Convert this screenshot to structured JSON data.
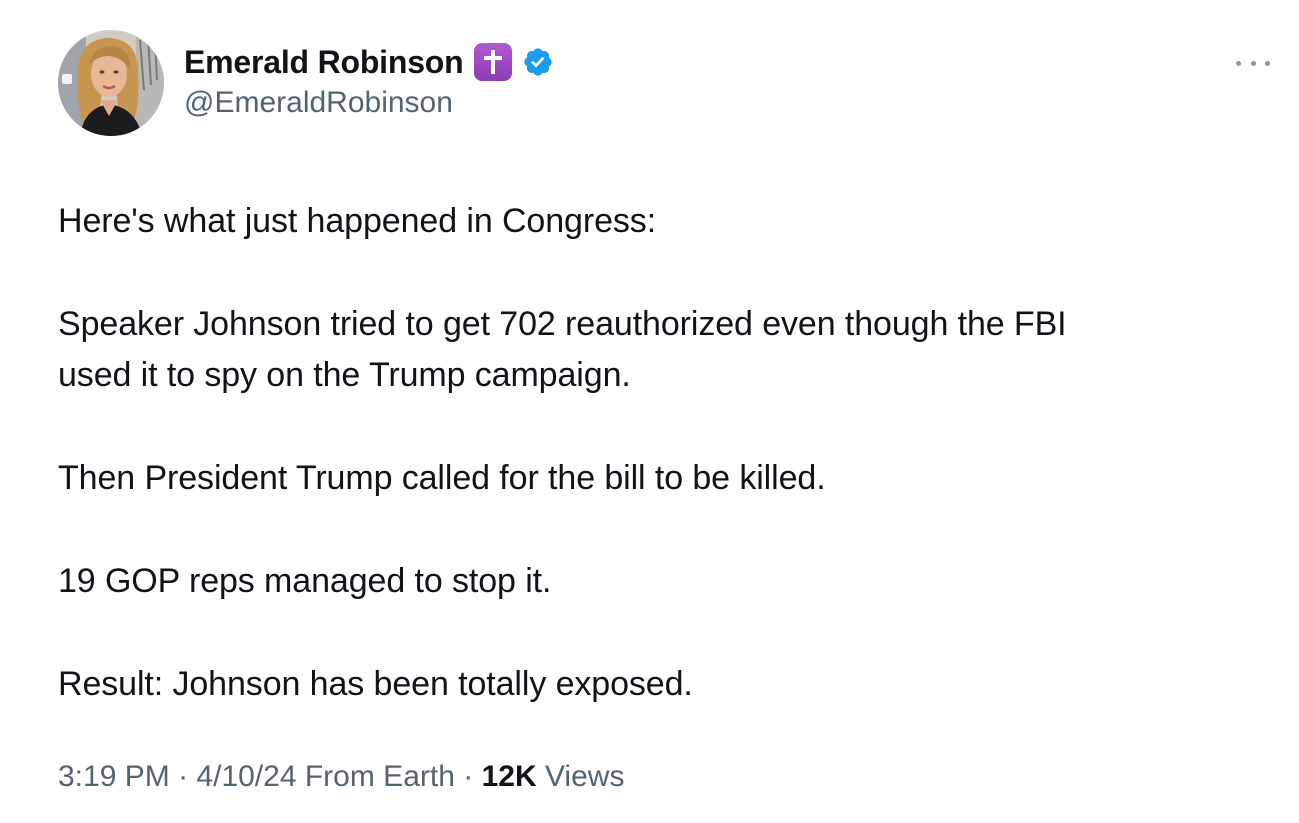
{
  "author": {
    "display_name": "Emerald Robinson",
    "handle": "@EmeraldRobinson",
    "badge_icon": "latin-cross-icon",
    "badge_color": "#9b4bc4",
    "verified_icon": "verified-checkmark-icon",
    "verified_color": "#1d9bf0"
  },
  "tweet": {
    "paragraphs": [
      {
        "lines": [
          "Here's what just happened in Congress:"
        ]
      },
      {
        "lines": [
          "Speaker Johnson tried to get 702 reauthorized even though the FBI",
          "used it to spy on the Trump campaign."
        ]
      },
      {
        "lines": [
          "Then President Trump called for the bill to be killed."
        ]
      },
      {
        "lines": [
          "19 GOP reps managed to stop it."
        ]
      },
      {
        "lines": [
          "Result: Johnson has been totally exposed."
        ]
      }
    ]
  },
  "meta": {
    "time": "3:19 PM",
    "date": "4/10/24",
    "source": "From Earth",
    "separator": "·",
    "views_count": "12K",
    "views_label": "Views"
  },
  "colors": {
    "text_primary": "#0f1419",
    "text_secondary": "#536471"
  },
  "more_menu_icon": "more-horizontal-icon"
}
